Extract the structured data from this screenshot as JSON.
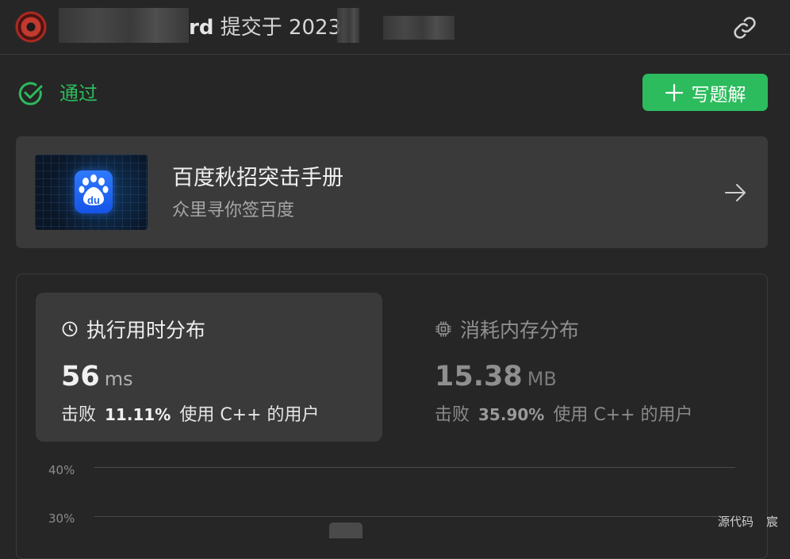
{
  "header": {
    "title_tail": "rd",
    "submitted_text": " 提交于 2023",
    "icons": {
      "avatar": "user-avatar",
      "link": "link-icon"
    }
  },
  "status": {
    "label": "通过",
    "color": "#2cbb5d",
    "icon": "check-circle-icon"
  },
  "actions": {
    "write_solution_label": "写题解",
    "write_solution_icon": "plus-icon"
  },
  "promo": {
    "title": "百度秋招突击手册",
    "subtitle": "众里寻你签百度",
    "logo_text": "du",
    "icon": "arrow-right-icon"
  },
  "stats": {
    "runtime": {
      "heading": "执行用时分布",
      "icon": "clock-icon",
      "value": "56",
      "unit": "ms",
      "beat_prefix": "击败",
      "beat_pct": "11.11%",
      "beat_suffix": "使用 C++ 的用户"
    },
    "memory": {
      "heading": "消耗内存分布",
      "icon": "chip-icon",
      "value": "15.38",
      "unit": "MB",
      "beat_prefix": "击败",
      "beat_pct": "35.90%",
      "beat_suffix": "使用 C++ 的用户"
    }
  },
  "chart": {
    "y_ticks": [
      "40%",
      "30%"
    ]
  },
  "bottom_tabs": [
    "源代码",
    "宸"
  ]
}
